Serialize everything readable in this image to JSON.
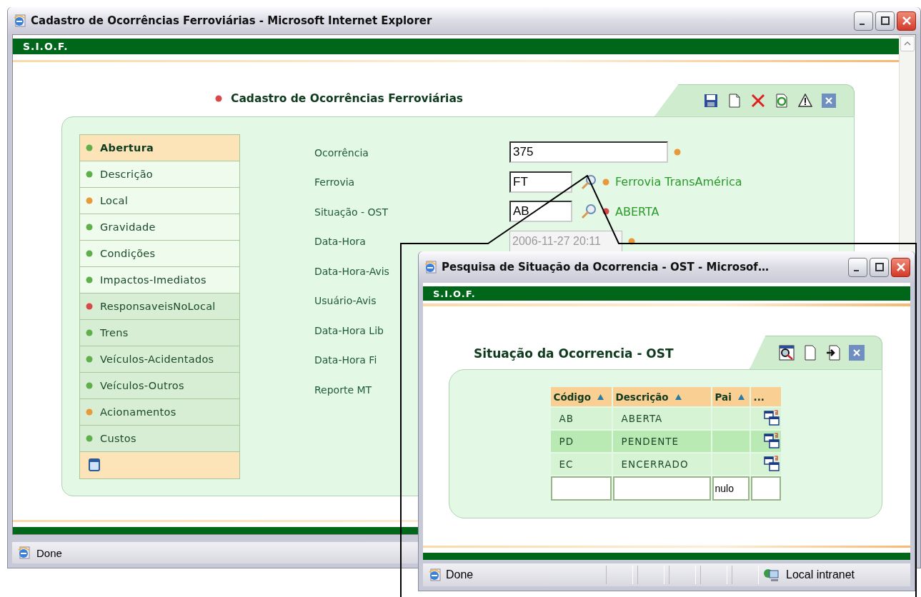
{
  "window": {
    "title": "Cadastro de Ocorrências Ferroviárias - Microsoft Internet Explorer",
    "brand": "S.I.O.F.",
    "status": "Done"
  },
  "page": {
    "title": "Cadastro de Ocorrências Ferroviárias"
  },
  "menu": [
    {
      "label": "Abertura",
      "color": "#5fb04a",
      "selected": true,
      "shaded": false
    },
    {
      "label": "Descrição",
      "color": "#5fb04a",
      "selected": false,
      "shaded": false
    },
    {
      "label": "Local",
      "color": "#e89a3a",
      "selected": false,
      "shaded": false
    },
    {
      "label": "Gravidade",
      "color": "#5fb04a",
      "selected": false,
      "shaded": false
    },
    {
      "label": "Condições",
      "color": "#5fb04a",
      "selected": false,
      "shaded": false
    },
    {
      "label": "Impactos-Imediatos",
      "color": "#5fb04a",
      "selected": false,
      "shaded": false
    },
    {
      "label": "ResponsaveisNoLocal",
      "color": "#d84a4a",
      "selected": false,
      "shaded": true
    },
    {
      "label": "Trens",
      "color": "#5fb04a",
      "selected": false,
      "shaded": true
    },
    {
      "label": "Veículos-Acidentados",
      "color": "#5fb04a",
      "selected": false,
      "shaded": true
    },
    {
      "label": "Veículos-Outros",
      "color": "#5fb04a",
      "selected": false,
      "shaded": true
    },
    {
      "label": "Acionamentos",
      "color": "#e89a3a",
      "selected": false,
      "shaded": true
    },
    {
      "label": "Custos",
      "color": "#5fb04a",
      "selected": false,
      "shaded": true
    }
  ],
  "form": [
    {
      "label": "Ocorrência",
      "kind": "wide",
      "value": "375",
      "color": "#e89a3a",
      "disabled": false
    },
    {
      "label": "Ferrovia",
      "kind": "lookup",
      "value": "FT",
      "color": "#e89a3a",
      "description": "Ferrovia TransAmérica",
      "disabled": false
    },
    {
      "label": "Situação - OST",
      "kind": "lookup",
      "value": "AB",
      "color": "#d84a4a",
      "description": "ABERTA",
      "disabled": false
    },
    {
      "label": "Data-Hora",
      "kind": "wide",
      "value": "2006-11-27 20:11",
      "color": "#e89a3a",
      "disabled": true
    },
    {
      "label": "Data-Hora-Avis",
      "kind": "label"
    },
    {
      "label": "Usuário-Avis",
      "kind": "label"
    },
    {
      "label": "Data-Hora Lib",
      "kind": "label"
    },
    {
      "label": "Data-Hora Fi",
      "kind": "label"
    },
    {
      "label": "Reporte MT",
      "kind": "label"
    }
  ],
  "popup": {
    "title": "Pesquisa de Situação da Ocorrencia - OST - Microsof…",
    "brand": "S.I.O.F.",
    "heading": "Situação da Ocorrencia - OST",
    "columns": [
      "Código",
      "Descrição",
      "Pai",
      "..."
    ],
    "rows": [
      {
        "code": "AB",
        "description": "ABERTA",
        "selected": false
      },
      {
        "code": "PD",
        "description": "PENDENTE",
        "selected": true
      },
      {
        "code": "EC",
        "description": "ENCERRADO",
        "selected": false
      }
    ],
    "filter": {
      "pai": "nulo"
    },
    "status": "Done",
    "zone": "Local intranet"
  }
}
